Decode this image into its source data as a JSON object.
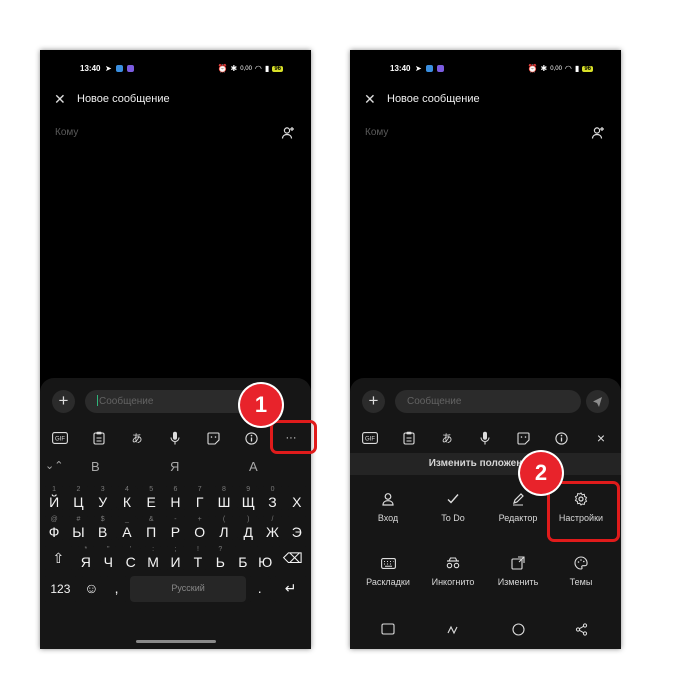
{
  "status": {
    "time": "13:40",
    "battery": "96",
    "net": "4G",
    "speed": "0,00"
  },
  "compose": {
    "title": "Новое сообщение",
    "to_placeholder": "Кому",
    "message_placeholder": "Сообщение"
  },
  "toolbar": {
    "gif_label": "GIF",
    "translate_glyph": "あ",
    "more_label": "···",
    "close_label": "×"
  },
  "suggestions": [
    "В",
    "Я",
    "А"
  ],
  "keyboard": {
    "row1": [
      {
        "k": "Й",
        "d": "1"
      },
      {
        "k": "Ц",
        "d": "2"
      },
      {
        "k": "У",
        "d": "3"
      },
      {
        "k": "К",
        "d": "4"
      },
      {
        "k": "Е",
        "d": "5"
      },
      {
        "k": "Н",
        "d": "6"
      },
      {
        "k": "Г",
        "d": "7"
      },
      {
        "k": "Ш",
        "d": "8"
      },
      {
        "k": "Щ",
        "d": "9"
      },
      {
        "k": "З",
        "d": "0"
      },
      {
        "k": "Х",
        "d": ""
      }
    ],
    "row2": [
      {
        "k": "Ф",
        "d": "@"
      },
      {
        "k": "Ы",
        "d": "#"
      },
      {
        "k": "В",
        "d": "$"
      },
      {
        "k": "А",
        "d": "_"
      },
      {
        "k": "П",
        "d": "&"
      },
      {
        "k": "Р",
        "d": "-"
      },
      {
        "k": "О",
        "d": "+"
      },
      {
        "k": "Л",
        "d": "("
      },
      {
        "k": "Д",
        "d": ")"
      },
      {
        "k": "Ж",
        "d": "/"
      },
      {
        "k": "Э",
        "d": ""
      }
    ],
    "row3": [
      {
        "k": "Я",
        "d": "*"
      },
      {
        "k": "Ч",
        "d": "\""
      },
      {
        "k": "С",
        "d": "'"
      },
      {
        "k": "М",
        "d": ":"
      },
      {
        "k": "И",
        "d": ";"
      },
      {
        "k": "Т",
        "d": "!"
      },
      {
        "k": "Ь",
        "d": "?"
      },
      {
        "k": "Б",
        "d": ""
      },
      {
        "k": "Ю",
        "d": ""
      }
    ],
    "numbers_label": "123",
    "comma": ",",
    "space_label": "Русский",
    "period": "."
  },
  "menu": {
    "banner": "Изменить положение э",
    "row1": [
      {
        "label": "Вход",
        "icon": "person-icon"
      },
      {
        "label": "To Do",
        "icon": "check-icon"
      },
      {
        "label": "Редактор",
        "icon": "pen-icon"
      },
      {
        "label": "Настройки",
        "icon": "gear-icon"
      }
    ],
    "row2": [
      {
        "label": "Раскладки",
        "icon": "keyboard-icon"
      },
      {
        "label": "Инкогнито",
        "icon": "incognito-icon"
      },
      {
        "label": "Изменить",
        "icon": "resize-icon"
      },
      {
        "label": "Темы",
        "icon": "palette-icon"
      }
    ]
  },
  "annotations": [
    {
      "number": "1",
      "target": "more-options-button"
    },
    {
      "number": "2",
      "target": "settings-tile"
    }
  ],
  "colors": {
    "highlight": "#e01b1b",
    "badge": "#e8232b",
    "cursor": "#2fb57a"
  }
}
